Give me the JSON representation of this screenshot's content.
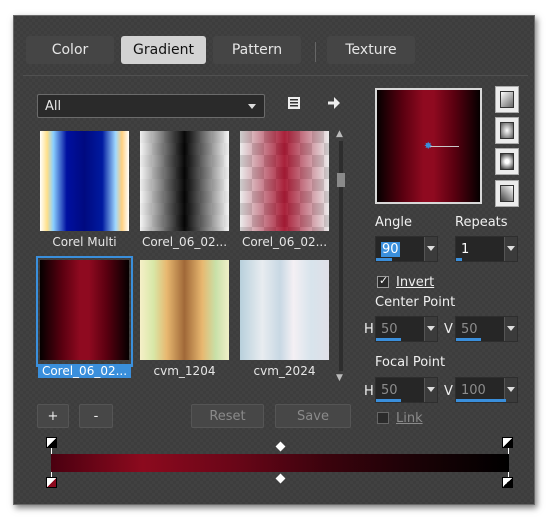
{
  "tabs": [
    {
      "label": "Color",
      "active": false
    },
    {
      "label": "Gradient",
      "active": true
    },
    {
      "label": "Pattern",
      "active": false
    },
    {
      "label": "Texture",
      "active": false
    }
  ],
  "category": {
    "selected": "All"
  },
  "icons": {
    "library": "library-icon",
    "import": "arrow-right-icon"
  },
  "thumbnails": [
    {
      "label": "Corel Multi"
    },
    {
      "label": "Corel_06_02..."
    },
    {
      "label": "Corel_06_02..."
    },
    {
      "label": "Corel_06_02...",
      "selected": true
    },
    {
      "label": "cvm_1204"
    },
    {
      "label": "cvm_2024"
    }
  ],
  "buttons": {
    "add": "+",
    "remove": "-",
    "reset": "Reset",
    "save": "Save"
  },
  "angle": {
    "label": "Angle",
    "value": "90"
  },
  "repeats": {
    "label": "Repeats",
    "value": "1"
  },
  "invert": {
    "label": "Invert",
    "checked": true
  },
  "center_point": {
    "label": "Center Point",
    "h_label": "H",
    "h": "50",
    "v_label": "V",
    "v": "50"
  },
  "focal_point": {
    "label": "Focal Point",
    "h_label": "H",
    "h": "50",
    "v_label": "V",
    "v": "100"
  },
  "link": {
    "label": "Link",
    "checked": false
  },
  "colors": {
    "accent": "#3a8fdc",
    "gradient_dark": "#000000",
    "gradient_red": "#8c0a1e"
  }
}
